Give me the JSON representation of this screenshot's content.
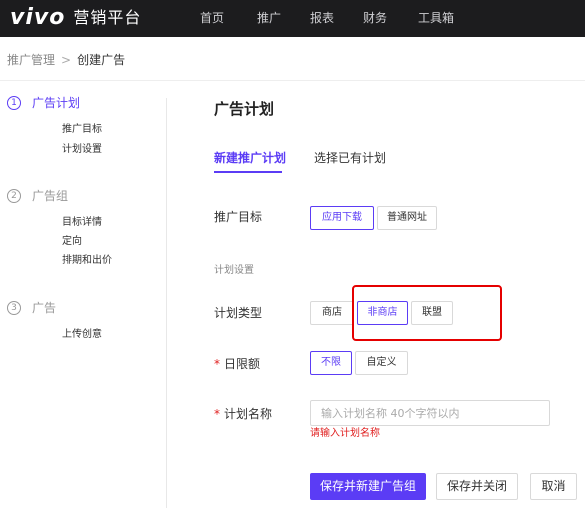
{
  "brand": {
    "logo_text": "vivo",
    "platform_name": "营销平台"
  },
  "nav": {
    "items": [
      "首页",
      "推广",
      "报表",
      "财务",
      "工具箱"
    ]
  },
  "breadcrumb": {
    "parent": "推广管理",
    "separator": ">",
    "current": "创建广告"
  },
  "steps": [
    {
      "number": "1",
      "title": "广告计划",
      "active": true,
      "subs": [
        "推广目标",
        "计划设置"
      ]
    },
    {
      "number": "2",
      "title": "广告组",
      "active": false,
      "subs": [
        "目标详情",
        "定向",
        "排期和出价"
      ]
    },
    {
      "number": "3",
      "title": "广告",
      "active": false,
      "subs": [
        "上传创意"
      ]
    }
  ],
  "panel": {
    "title": "广告计划",
    "tabs": [
      {
        "label": "新建推广计划",
        "active": true
      },
      {
        "label": "选择已有计划",
        "active": false
      }
    ]
  },
  "form": {
    "promotion_goal": {
      "label": "推广目标",
      "options": [
        "应用下载",
        "普通网址"
      ],
      "selected": "应用下载"
    },
    "section_label": "计划设置",
    "plan_type": {
      "label": "计划类型",
      "options": [
        "商店",
        "非商店",
        "联盟"
      ],
      "selected": "非商店"
    },
    "daily_budget": {
      "required_mark": "*",
      "label": "日限额",
      "options": [
        "不限",
        "自定义"
      ],
      "selected": "不限"
    },
    "plan_name": {
      "required_mark": "*",
      "label": "计划名称",
      "value": "",
      "placeholder": "输入计划名称 40个字符以内",
      "error": "请输入计划名称"
    }
  },
  "actions": {
    "save_and_new_group": "保存并新建广告组",
    "save_and_close": "保存并关闭",
    "cancel": "取消"
  },
  "colors": {
    "accent": "#5b3cf5",
    "topbar": "#1c1c1e",
    "error": "#e02020",
    "highlight": "#e50000"
  }
}
